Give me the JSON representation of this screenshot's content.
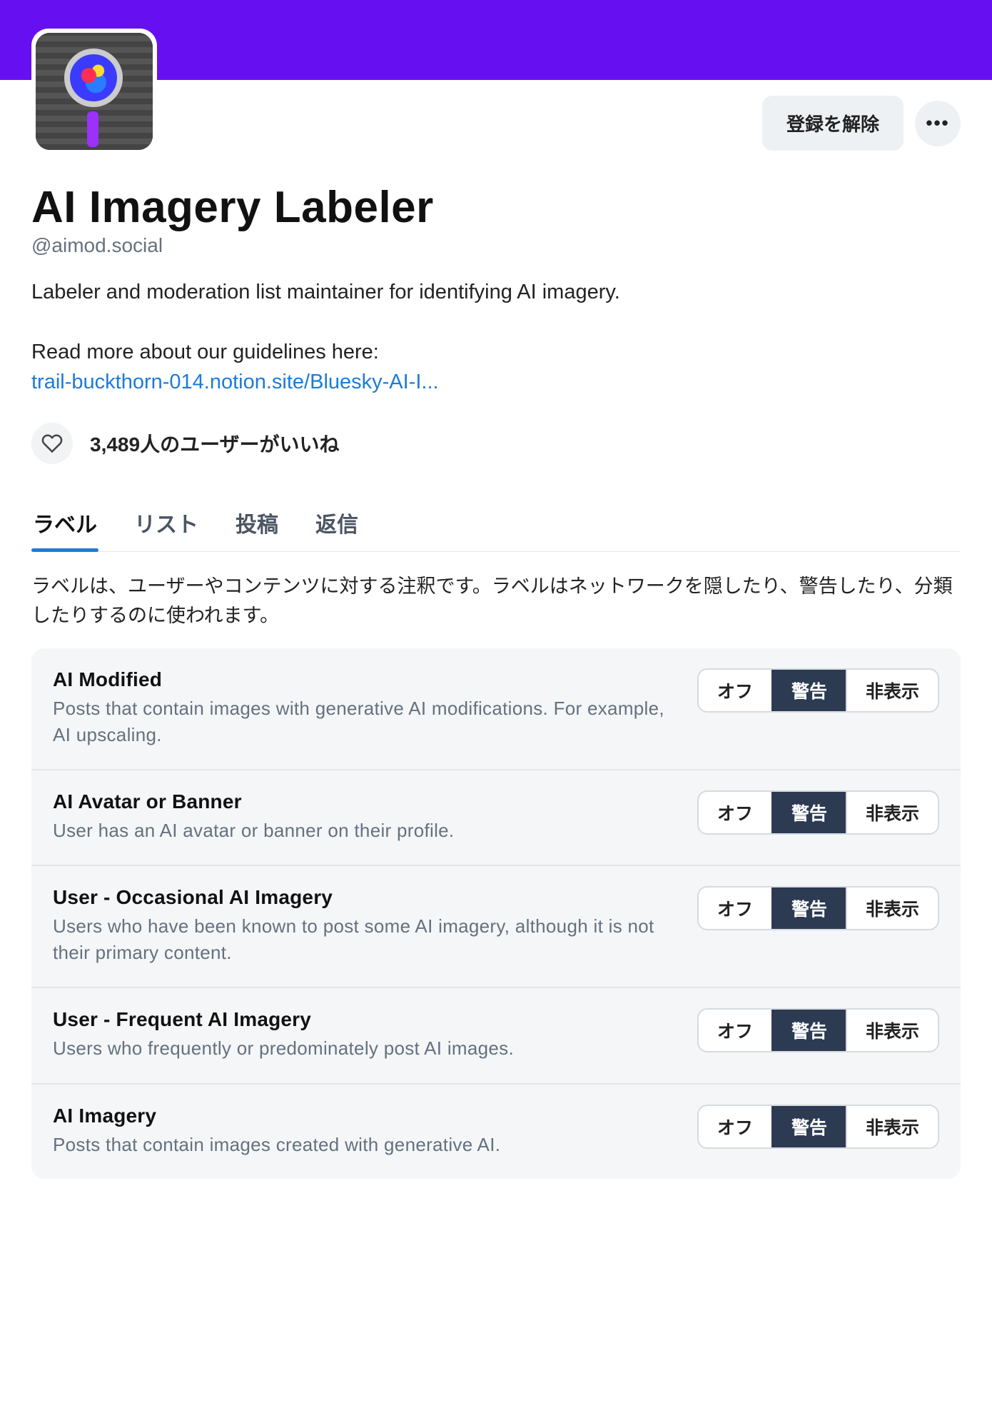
{
  "profile": {
    "display_name": "AI Imagery Labeler",
    "handle": "@aimod.social",
    "bio_line1": "Labeler and moderation list maintainer for identifying AI imagery.",
    "bio_line2": "Read more about our guidelines here:",
    "bio_link": "trail-buckthorn-014.notion.site/Bluesky-AI-I...",
    "likes_text": "3,489人のユーザーがいいね",
    "unsub_label": "登録を解除"
  },
  "tabs": {
    "items": [
      "ラベル",
      "リスト",
      "投稿",
      "返信"
    ],
    "active_index": 0,
    "description": "ラベルは、ユーザーやコンテンツに対する注釈です。ラベルはネットワークを隠したり、警告したり、分類したりするのに使われます。"
  },
  "segmented_options": [
    "オフ",
    "警告",
    "非表示"
  ],
  "labels": [
    {
      "title": "AI Modified",
      "desc": "Posts that contain images with generative AI modifications. For example, AI upscaling.",
      "selected": 1
    },
    {
      "title": "AI Avatar or Banner",
      "desc": "User has an AI avatar or banner on their profile.",
      "selected": 1
    },
    {
      "title": "User - Occasional AI Imagery",
      "desc": "Users who have been known to post some AI imagery, although it is not their primary content.",
      "selected": 1
    },
    {
      "title": "User - Frequent AI Imagery",
      "desc": "Users who frequently or predominately post AI images.",
      "selected": 1
    },
    {
      "title": "AI Imagery",
      "desc": "Posts that contain images created with generative AI.",
      "selected": 1
    }
  ]
}
